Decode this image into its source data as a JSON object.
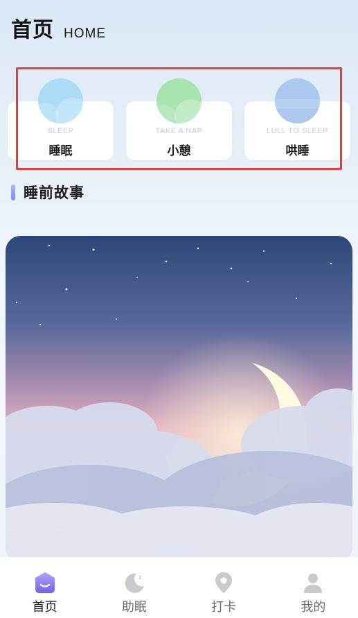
{
  "header": {
    "title_cn": "首页",
    "title_en": "HOME"
  },
  "cards": [
    {
      "sub": "SLEEP",
      "label": "睡眠",
      "bubble_color": "#a9dbf7"
    },
    {
      "sub": "TAKE A NAP",
      "label": "小憩",
      "bubble_color": "#a3e3aa"
    },
    {
      "sub": "LULL TO SLEEP",
      "label": "哄睡",
      "bubble_color": "#a9c6ee"
    }
  ],
  "section": {
    "title": "睡前故事"
  },
  "banner": {
    "image": "night-sky-moon-clouds"
  },
  "tabbar": {
    "tabs": [
      {
        "label": "首页",
        "icon": "home-icon",
        "active": true
      },
      {
        "label": "助眠",
        "icon": "moon-sleep-icon",
        "active": false
      },
      {
        "label": "打卡",
        "icon": "location-pin-icon",
        "active": false
      },
      {
        "label": "我的",
        "icon": "profile-icon",
        "active": false
      }
    ]
  },
  "colors": {
    "accent": "#7b8cff",
    "highlight_border": "#e43b3b"
  }
}
